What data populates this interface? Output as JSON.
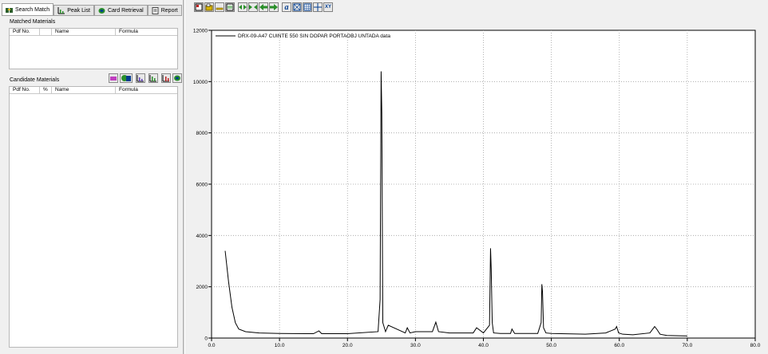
{
  "tabs": [
    {
      "label": "Search Match",
      "icon": "binoculars-icon",
      "active": true
    },
    {
      "label": "Peak List",
      "icon": "peak-chart-icon",
      "active": false
    },
    {
      "label": "Card Retrieval",
      "icon": "card-icon",
      "active": false
    },
    {
      "label": "Report",
      "icon": "report-icon",
      "active": false
    }
  ],
  "matched": {
    "title": "Matched Materials",
    "columns": [
      "Pdf No.",
      "",
      "Name",
      "Formula"
    ]
  },
  "candidate": {
    "title": "Candidate Materials",
    "columns": [
      "Pdf No.",
      "%",
      "Name",
      "Formula"
    ],
    "tools": [
      "candidate-search-icon",
      "candidate-filter-icon",
      "candidate-peaks-icon",
      "candidate-peaks-alt-icon",
      "candidate-plot-icon",
      "candidate-match-icon"
    ]
  },
  "toolbar": {
    "buttons": [
      "print-icon",
      "open-icon",
      "minimize-icon",
      "export-icon",
      "zoom-horizontal-icon",
      "zoom-fit-icon",
      "pan-left-icon",
      "pan-right-icon",
      "annotate-icon",
      "full-view-icon",
      "grid-icon",
      "cursor-icon",
      "xy-icon"
    ],
    "annotate_label": "a",
    "xy_label": "XY"
  },
  "chart_data": {
    "type": "line",
    "legend_position": "top-left",
    "series": [
      {
        "name": "DRX-09-A47 CUINTE 550 SIN DOPAR PORTAOBJ UNTADA data",
        "color": "#000000",
        "x": [
          2.0,
          2.5,
          3.0,
          3.5,
          4.0,
          5.0,
          7.0,
          10.0,
          15.0,
          15.8,
          16.2,
          20.0,
          24.5,
          24.8,
          24.95,
          25.05,
          25.2,
          25.6,
          26.0,
          28.5,
          28.8,
          29.2,
          30.0,
          32.5,
          33.0,
          33.4,
          35.0,
          38.5,
          39.0,
          40.0,
          40.9,
          41.05,
          41.15,
          41.3,
          41.5,
          42.5,
          44.0,
          44.2,
          44.6,
          48.0,
          48.5,
          48.6,
          48.7,
          48.85,
          49.2,
          50.0,
          55.0,
          58.0,
          59.4,
          59.6,
          59.9,
          60.5,
          62.0,
          64.5,
          65.2,
          65.5,
          66.0,
          67.0,
          70.0
        ],
        "y": [
          3400,
          2200,
          1200,
          600,
          350,
          250,
          200,
          180,
          170,
          280,
          170,
          170,
          250,
          1500,
          10400,
          8800,
          600,
          250,
          500,
          200,
          400,
          200,
          250,
          250,
          620,
          250,
          200,
          200,
          400,
          200,
          500,
          3500,
          2700,
          600,
          200,
          180,
          180,
          350,
          180,
          180,
          600,
          2100,
          1800,
          400,
          200,
          180,
          150,
          200,
          350,
          450,
          200,
          150,
          130,
          200,
          450,
          350,
          150,
          100,
          80
        ]
      }
    ],
    "xlim": [
      0.0,
      80.0
    ],
    "ylim": [
      0,
      12000
    ],
    "xticks": [
      "0.0",
      "10.0",
      "20.0",
      "30.0",
      "40.0",
      "50.0",
      "60.0",
      "70.0",
      "80.0"
    ],
    "yticks": [
      "0",
      "2000",
      "4000",
      "6000",
      "8000",
      "10000",
      "12000"
    ],
    "grid": true
  }
}
